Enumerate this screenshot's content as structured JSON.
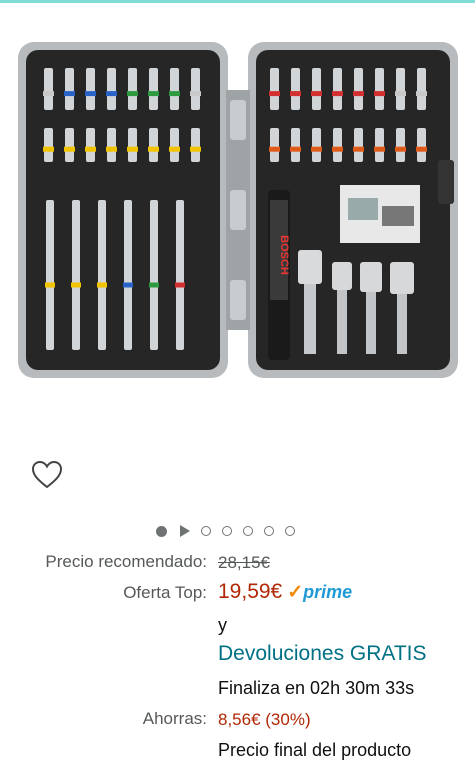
{
  "product": {
    "image_alt": "BOSCH"
  },
  "carousel": {
    "video_icon": "play-icon",
    "dots": 6
  },
  "pricing": {
    "recommended_label": "Precio recomendado:",
    "recommended_value": "28,15€",
    "offer_label": "Oferta Top:",
    "offer_value": "19,59€",
    "prime_check": "✓",
    "prime_word": "prime",
    "conjunction": "y",
    "returns": "Devoluciones GRATIS",
    "countdown": "Finaliza en 02h 30m 33s",
    "savings_label": "Ahorras:",
    "savings_value": "8,56€ (30%)",
    "final_note": "Precio final del producto"
  },
  "colors": {
    "price": "#b12704",
    "link": "#007185",
    "prime": "#1f9ad6",
    "prime_check": "#f08804"
  }
}
